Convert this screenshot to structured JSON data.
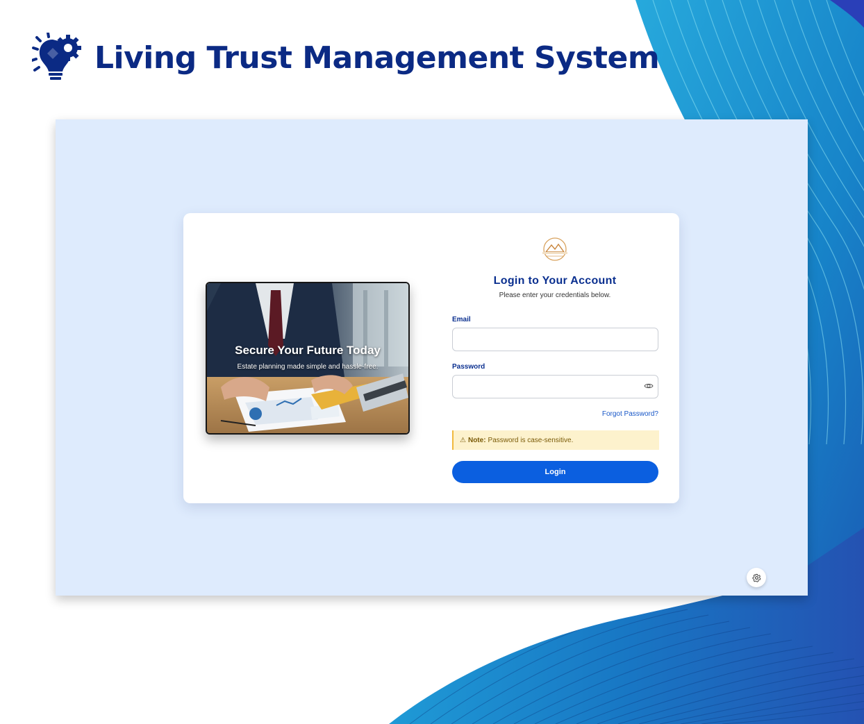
{
  "brand": {
    "title": "Living Trust Management System",
    "logo_icon": "lightbulb-gear-icon",
    "color": "#0b2a84"
  },
  "background": {
    "accent_colors": [
      "#1e8fd0",
      "#1566b8",
      "#2a3fb8"
    ]
  },
  "hero": {
    "title": "Secure Your Future Today",
    "subtitle": "Estate planning made simple and hassle-free."
  },
  "login": {
    "logo_icon": "mountain-emblem-icon",
    "heading": "Login to Your Account",
    "subheading": "Please enter your credentials below.",
    "email_label": "Email",
    "email_value": "",
    "password_label": "Password",
    "password_value": "",
    "password_toggle_icon": "eye-icon",
    "forgot_link": "Forgot Password?",
    "note_icon": "warning-icon",
    "note_prefix": "Note:",
    "note_text": "Password is case-sensitive.",
    "submit_label": "Login"
  },
  "settings": {
    "icon": "gear-icon"
  },
  "colors": {
    "primary": "#0b5fe0",
    "heading": "#0a2f8f",
    "window_bg": "#deebfd",
    "note_bg": "#fdf2cd"
  }
}
